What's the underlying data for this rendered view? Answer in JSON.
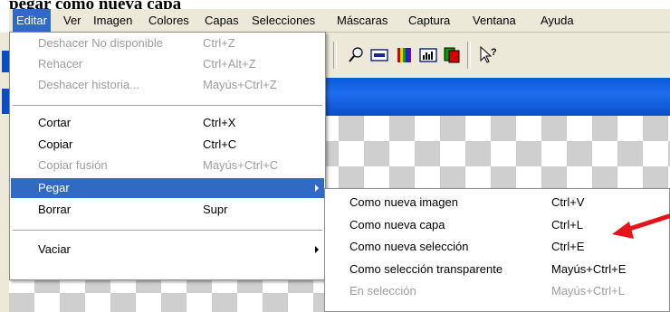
{
  "page_title": "pegar como nueva capa",
  "menubar": {
    "items": [
      "Editar",
      "Ver",
      "Imagen",
      "Colores",
      "Capas",
      "Selecciones",
      "Máscaras",
      "Captura",
      "Ventana",
      "Ayuda"
    ],
    "active": "Editar"
  },
  "edit_menu": {
    "undo": {
      "label": "Deshacer No disponible",
      "shortcut": "Ctrl+Z",
      "enabled": false
    },
    "redo": {
      "label": "Rehacer",
      "shortcut": "Ctrl+Alt+Z",
      "enabled": false
    },
    "undo_history": {
      "label": "Deshacer historia...",
      "shortcut": "Mayús+Ctrl+Z",
      "enabled": false
    },
    "cut": {
      "label": "Cortar",
      "shortcut": "Ctrl+X",
      "enabled": true
    },
    "copy": {
      "label": "Copiar",
      "shortcut": "Ctrl+C",
      "enabled": true
    },
    "copy_merged": {
      "label": "Copiar fusión",
      "shortcut": "Mayús+Ctrl+C",
      "enabled": false
    },
    "paste": {
      "label": "Pegar",
      "highlighted": true,
      "has_submenu": true
    },
    "delete": {
      "label": "Borrar",
      "shortcut": "Supr",
      "enabled": true
    },
    "empty": {
      "label": "Vaciar",
      "has_submenu": true
    }
  },
  "paste_submenu": {
    "new_image": {
      "label": "Como nueva imagen",
      "shortcut": "Ctrl+V",
      "enabled": true
    },
    "new_layer": {
      "label": "Como nueva capa",
      "shortcut": "Ctrl+L",
      "enabled": true
    },
    "new_selection": {
      "label": "Como nueva selección",
      "shortcut": "Ctrl+E",
      "enabled": true
    },
    "transparent_selection": {
      "label": "Como selección transparente",
      "shortcut": "Mayús+Ctrl+E",
      "enabled": true
    },
    "into_selection": {
      "label": "En selección",
      "shortcut": "Mayús+Ctrl+L",
      "enabled": false
    }
  },
  "colors": {
    "highlight": "#316ac5",
    "menu_bg": "#ece9d8",
    "disabled_text": "#9d9d9d",
    "arrow": "#e8131a",
    "title_blue": "#0a5bd8"
  },
  "toolbar_icons": [
    "zoom-icon",
    "overview-icon",
    "color-palette-icon",
    "histogram-icon",
    "layers-icon",
    "context-help-icon"
  ]
}
